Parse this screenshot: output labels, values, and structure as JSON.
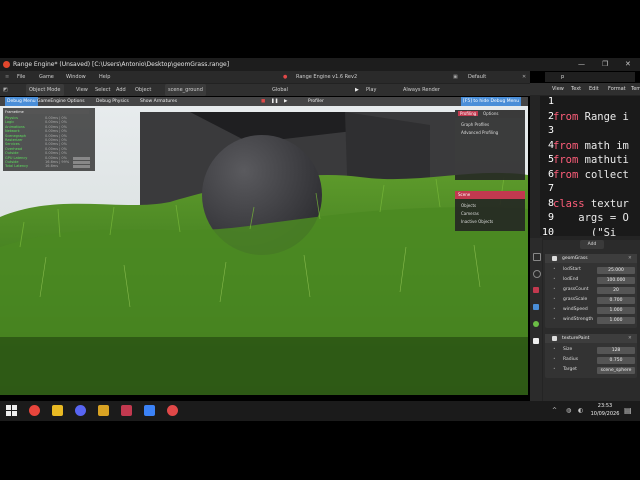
{
  "window": {
    "title": "Range Engine* (Unsaved) [C:\\Users\\Antonio\\Desktop\\geomGrass.range]",
    "controls": [
      "—",
      "❐",
      "✕"
    ]
  },
  "menubar": {
    "items": [
      "File",
      "Game",
      "Window",
      "Help"
    ],
    "center_title": "Range Engine v1.6 Rev2",
    "workspace": "Default"
  },
  "header": {
    "mode": "Object Mode",
    "items": [
      "View",
      "Select",
      "Add",
      "Object"
    ],
    "scene_object": "scene_ground",
    "transform": "Global",
    "play_label": "Play",
    "render_label": "Always Render"
  },
  "viewport": {
    "tabs": [
      "Debug Menu",
      "GameEngine Options",
      "Debug Physics",
      "Show Armatures"
    ],
    "center_label": "Profiler",
    "right_tab": "[F5] to hide Debug Menu",
    "debug_title": "Frametime",
    "debug_rows": [
      {
        "label": "Physics",
        "value": "0.00ms | 0%"
      },
      {
        "label": "Logic",
        "value": "0.00ms | 0%"
      },
      {
        "label": "Animations",
        "value": "0.00ms | 0%"
      },
      {
        "label": "Network",
        "value": "0.00ms | 0%"
      },
      {
        "label": "Scenegraph",
        "value": "0.00ms | 0%"
      },
      {
        "label": "Rasterizer",
        "value": "0.00ms | 0%"
      },
      {
        "label": "Services",
        "value": "0.00ms | 0%"
      },
      {
        "label": "Overhead",
        "value": "0.00ms | 0%"
      },
      {
        "label": "Outside",
        "value": "0.00ms | 0%"
      },
      {
        "label": "GPU Latency",
        "value": "0.00ms | 0%"
      },
      {
        "label": "Outside",
        "value": "16.6ms | 99%"
      },
      {
        "label": "Total Latency",
        "value": "16.6ms"
      }
    ],
    "profiling": {
      "tabs": [
        "Profiling",
        "Options"
      ],
      "items": [
        "Graph Profiles",
        "Advanced Profiling"
      ]
    },
    "scene_panel": {
      "title": "Scene",
      "items": [
        "Objects",
        "Cameras",
        "Inactive Objects"
      ]
    }
  },
  "code": {
    "lines": [
      {
        "n": "1",
        "text": ""
      },
      {
        "n": "2",
        "kw": "from",
        "text": " Range i"
      },
      {
        "n": "3",
        "text": ""
      },
      {
        "n": "4",
        "kw": "from",
        "text": " math im"
      },
      {
        "n": "5",
        "kw": "from",
        "text": " mathuti"
      },
      {
        "n": "6",
        "kw": "from",
        "text": " collect"
      },
      {
        "n": "7",
        "text": ""
      },
      {
        "n": "8",
        "kw": "class",
        "text": " textur"
      },
      {
        "n": "9",
        "text": "    args = O"
      },
      {
        "n": "10",
        "text": "      (\"Si"
      }
    ],
    "header_menu": [
      "View",
      "Text",
      "Edit",
      "Format",
      "Tem"
    ],
    "file_tab": "p"
  },
  "properties": {
    "components": [
      {
        "name": "geomGrass",
        "rows": [
          {
            "label": "lodStart",
            "value": "25.000"
          },
          {
            "label": "lodEnd",
            "value": "100.000"
          },
          {
            "label": "grassCount",
            "value": "20"
          },
          {
            "label": "grassScale",
            "value": "0.700"
          },
          {
            "label": "windSpeed",
            "value": "1.000"
          },
          {
            "label": "windStrength",
            "value": "1.000"
          }
        ]
      },
      {
        "name": "texturePaint",
        "rows": [
          {
            "label": "Size",
            "value": "128"
          },
          {
            "label": "Radius",
            "value": "0.750"
          },
          {
            "label": "Target",
            "value": "scene_sphere"
          }
        ]
      }
    ],
    "add_label": "Add"
  },
  "taskbar": {
    "time": "23:53",
    "date": "10/09/2026"
  },
  "colors": {
    "accent": "#4a8ed8",
    "grass": "#3f7a1f",
    "code_keyword": "#ff5e7a"
  }
}
